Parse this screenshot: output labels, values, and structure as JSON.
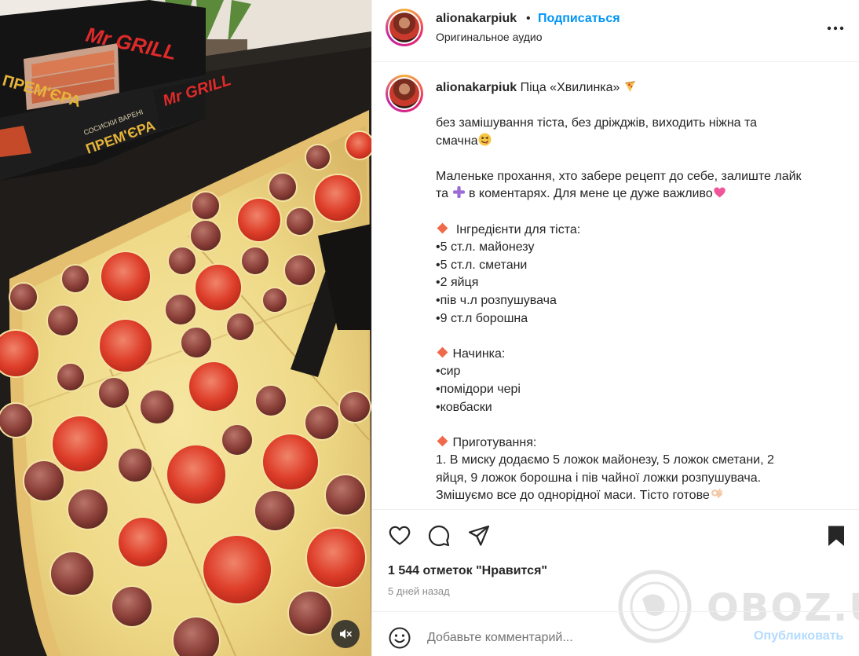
{
  "header": {
    "username": "alionakarpiuk",
    "separator": "•",
    "follow_label": "Подписаться",
    "audio_label": "Оригинальное аудио",
    "more_icon": "more-horizontal-icon"
  },
  "caption": {
    "username": "alionakarpiuk",
    "title": "Піца «Хвилинка»",
    "lines": [
      "без замішування тіста, без дріжджів, виходить ніжна та",
      "смачна",
      "",
      "Маленьке прохання, хто забере рецепт до себе, залиште лайк",
      "та",
      "в коментарях. Для мене це дуже важливо",
      "",
      "Інгредієнти для тіста:",
      "•5 ст.л. майонезу",
      "•5 ст.л. сметани",
      "•2 яйця",
      "•пів ч.л розпушувача",
      "•9 ст.л борошна",
      "",
      "Начинка:",
      "•сир",
      "•помідори чері",
      "•ковбаски",
      "",
      "Приготування:",
      "1. В миску додаємо 5 ложок майонезу, 5 ложок сметани, 2",
      "яйця, 9 ложок борошна і пів чайної ложки розпушувача.",
      "Змішуємо все до однорідної маси. Тісто готове"
    ]
  },
  "media": {
    "package_brand": "Mr GRILL",
    "package_product": "ПРЕМ'ЄРА",
    "package_subtitle": "СОСИСКИ ВАРЕНІ",
    "mute_icon": "speaker-muted-icon"
  },
  "actions": {
    "like_icon": "heart-icon",
    "comment_icon": "comment-bubble-icon",
    "share_icon": "paper-plane-icon",
    "save_icon": "bookmark-icon",
    "likes_text": "1 544 отметок \"Нравится\"",
    "time_text": "5 дней назад"
  },
  "comment": {
    "placeholder": "Добавьте комментарий...",
    "publish_label": "Опубликовать"
  },
  "watermark": {
    "text": "OBOZ.UA"
  },
  "colors": {
    "accent": "#0095f6",
    "publish_disabled": "#b3dbff",
    "text": "#262626",
    "muted": "#8e8e8e",
    "divider": "#efefef"
  }
}
